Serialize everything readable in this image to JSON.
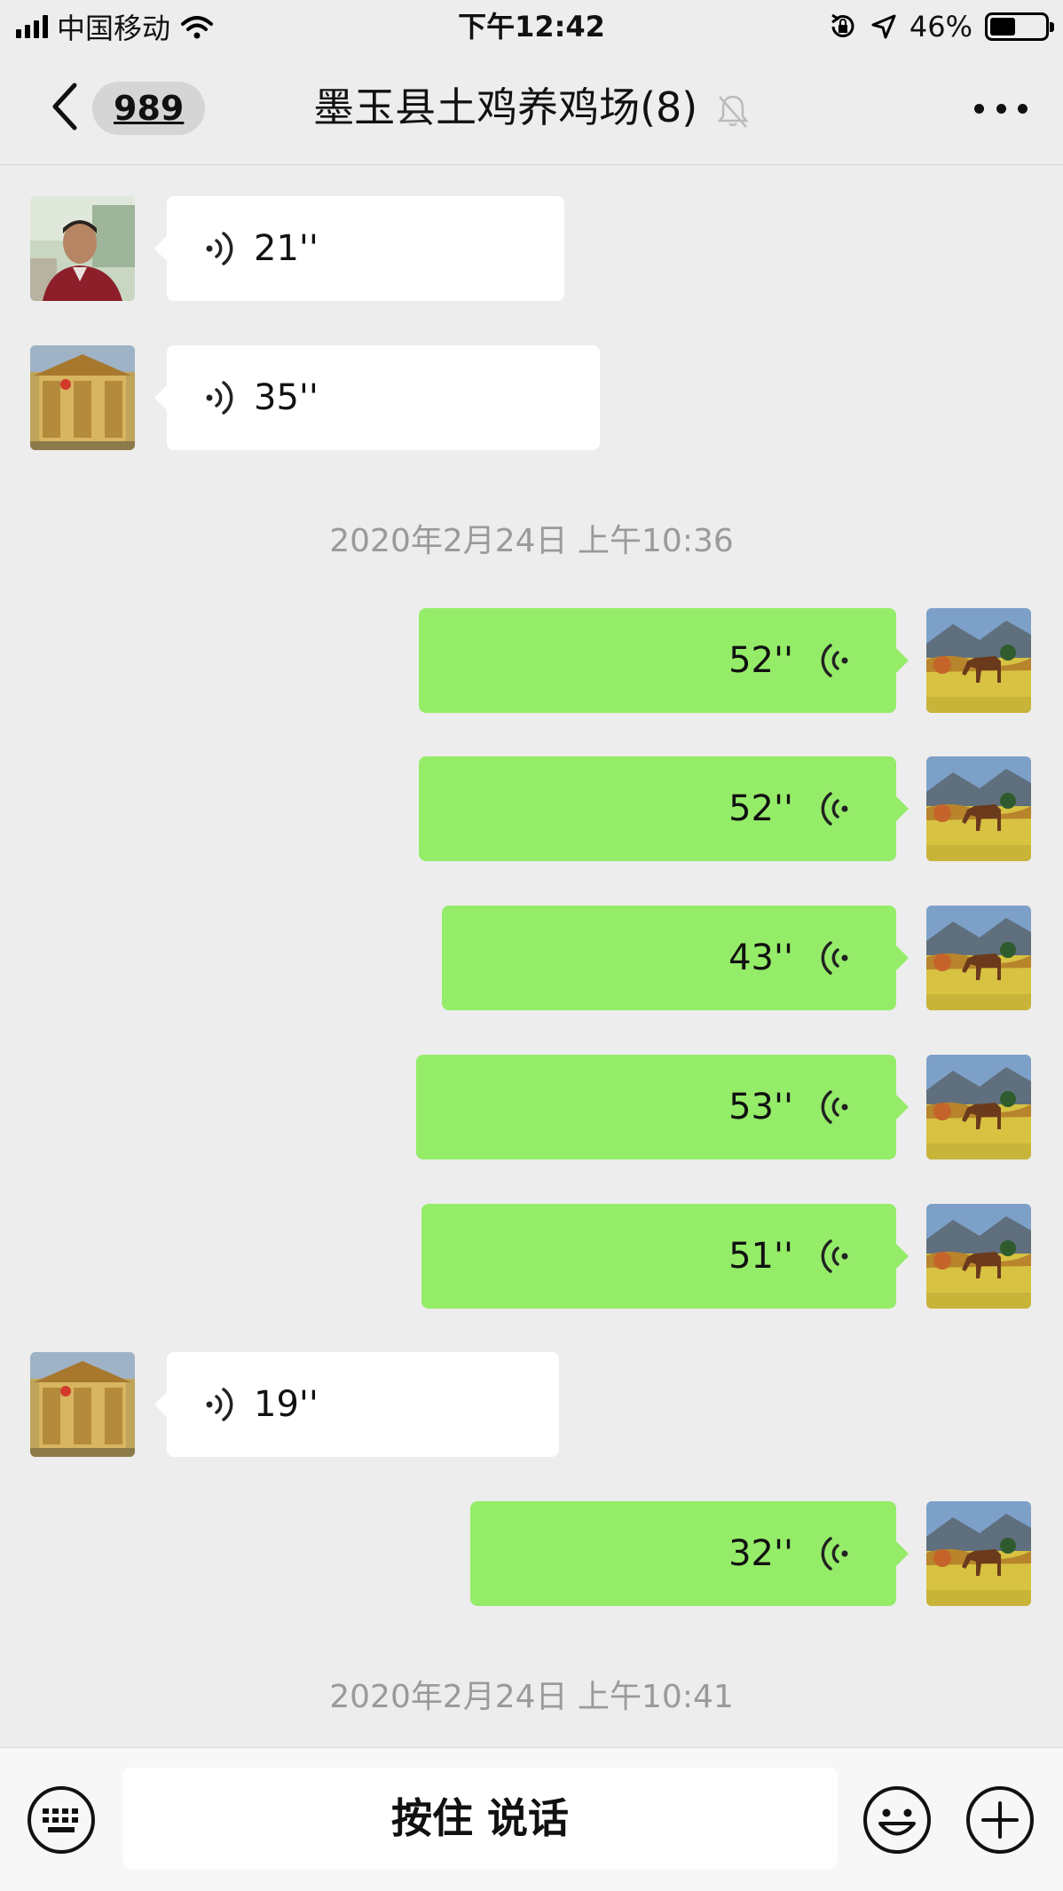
{
  "status_bar": {
    "carrier": "中国移动",
    "time": "下午12:42",
    "battery": "46%",
    "battery_level": 0.46
  },
  "nav": {
    "back_badge": "989",
    "title": "墨玉县土鸡养鸡场(8)"
  },
  "messages": [
    {
      "direction": "in",
      "duration": "21''",
      "avatar": "man-portrait"
    },
    {
      "direction": "in",
      "duration": "35''",
      "avatar": "pavilion"
    },
    {
      "direction": "out",
      "duration": "52''",
      "avatar": "horse-landscape"
    },
    {
      "direction": "out",
      "duration": "52''",
      "avatar": "horse-landscape"
    },
    {
      "direction": "out",
      "duration": "43''",
      "avatar": "horse-landscape"
    },
    {
      "direction": "out",
      "duration": "53''",
      "avatar": "horse-landscape"
    },
    {
      "direction": "out",
      "duration": "51''",
      "avatar": "horse-landscape"
    },
    {
      "direction": "in",
      "duration": "19''",
      "avatar": "pavilion"
    },
    {
      "direction": "out",
      "duration": "32''",
      "avatar": "horse-landscape"
    }
  ],
  "timestamps": [
    "2020年2月24日 上午10:36",
    "2020年2月24日 上午10:41"
  ],
  "input_bar": {
    "talk_label": "按住 说话"
  },
  "colors": {
    "background": "#ededed",
    "bubble_out": "#95ec69",
    "bubble_in": "#ffffff",
    "timestamp": "#9a9a9a"
  }
}
